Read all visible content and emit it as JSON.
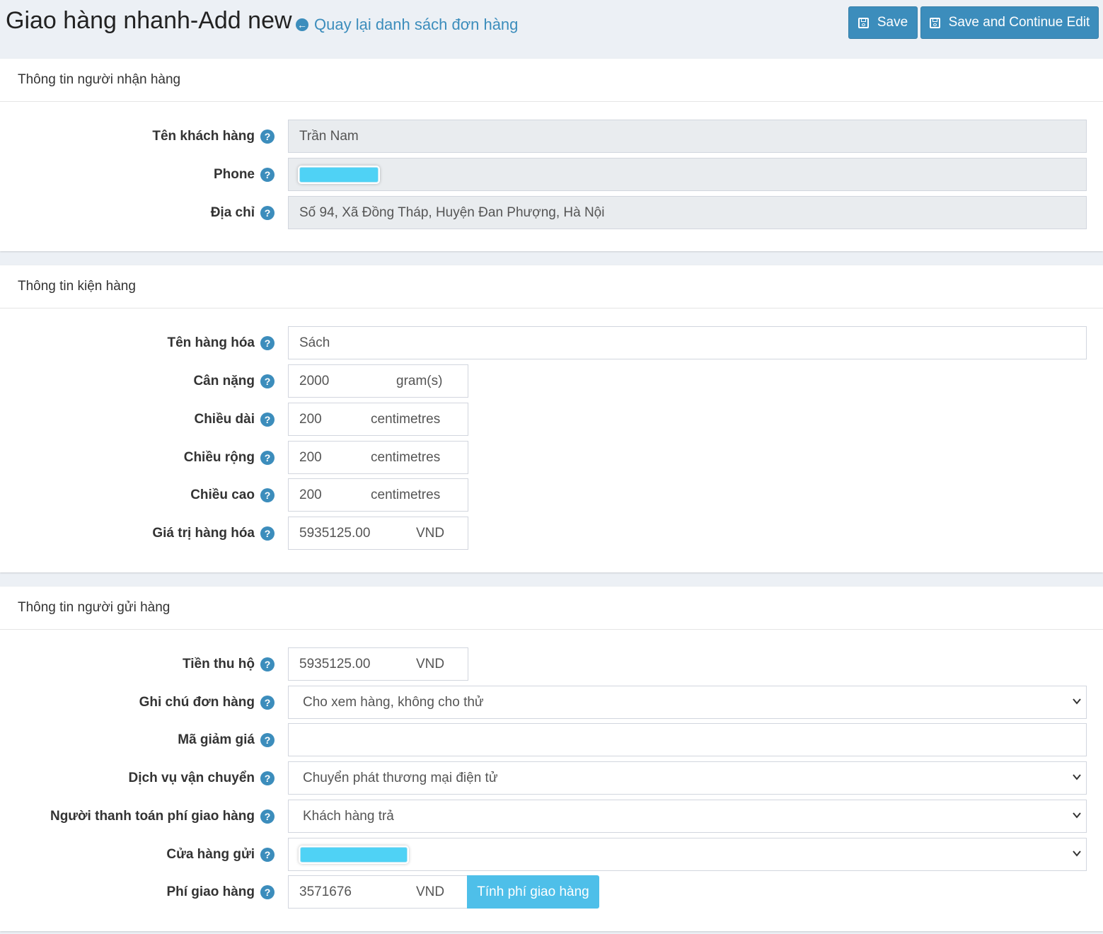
{
  "header": {
    "title": "Giao hàng nhanh-Add new",
    "back_link": "Quay lại danh sách đơn hàng",
    "save_label": "Save",
    "save_continue_label": "Save and Continue Edit"
  },
  "recipient": {
    "heading": "Thông tin người nhận hàng",
    "name_label": "Tên khách hàng",
    "name_value": "Trần Nam",
    "phone_label": "Phone",
    "address_label": "Địa chỉ",
    "address_value": "Số 94, Xã Đồng Tháp, Huyện Đan Phượng, Hà Nội"
  },
  "package": {
    "heading": "Thông tin kiện hàng",
    "goods_label": "Tên hàng hóa",
    "goods_value": "Sách",
    "weight_label": "Cân nặng",
    "weight_value": "2000",
    "weight_unit": "gram(s)",
    "length_label": "Chiều dài",
    "length_value": "200",
    "length_unit": "centimetres",
    "width_label": "Chiều rộng",
    "width_value": "200",
    "width_unit": "centimetres",
    "height_label": "Chiều cao",
    "height_value": "200",
    "height_unit": "centimetres",
    "value_label": "Giá trị hàng hóa",
    "value_value": "5935125.00",
    "value_unit": "VND"
  },
  "sender": {
    "heading": "Thông tin người gửi hàng",
    "cod_label": "Tiền thu hộ",
    "cod_value": "5935125.00",
    "cod_unit": "VND",
    "note_label": "Ghi chú đơn hàng",
    "note_value": "Cho xem hàng, không cho thử",
    "coupon_label": "Mã giảm giá",
    "coupon_value": "",
    "service_label": "Dịch vụ vận chuyển",
    "service_value": "Chuyển phát thương mại điện tử",
    "payer_label": "Người thanh toán phí giao hàng",
    "payer_value": "Khách hàng trả",
    "store_label": "Cửa hàng gửi",
    "fee_label": "Phí giao hàng",
    "fee_value": "3571676",
    "fee_unit": "VND",
    "calc_button": "Tính phí giao hàng"
  },
  "colors": {
    "primary": "#3c8dbc",
    "info": "#4ebfe9",
    "redaction": "#4fd2f5"
  },
  "icons": {
    "help": "question-circle-icon",
    "back": "arrow-circle-left-icon",
    "save": "floppy-disk-icon",
    "dropdown": "chevron-down-icon"
  }
}
